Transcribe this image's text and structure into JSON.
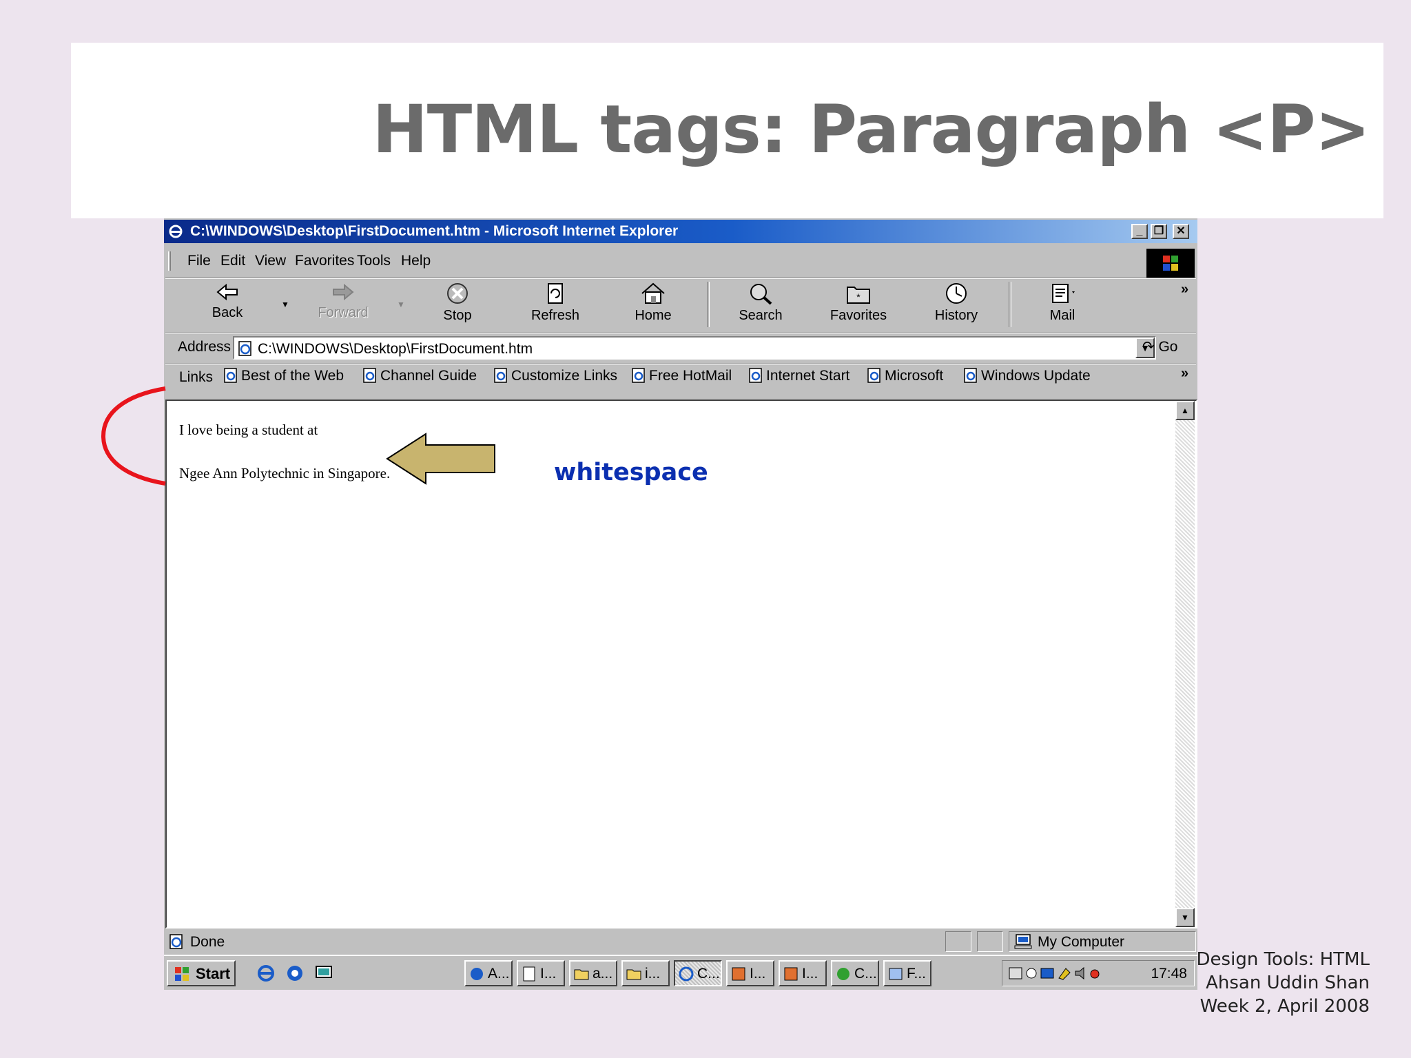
{
  "slide": {
    "title": "HTML tags: Paragraph <P>",
    "annotation": "whitespace",
    "footer": [
      "Design Tools: HTML",
      "Ahsan Uddin Shan",
      "Week 2, April 2008"
    ]
  },
  "window": {
    "title": "C:\\WINDOWS\\Desktop\\FirstDocument.htm - Microsoft Internet Explorer",
    "controls": [
      "minimize",
      "restore",
      "close"
    ]
  },
  "menu": [
    "File",
    "Edit",
    "View",
    "Favorites",
    "Tools",
    "Help"
  ],
  "toolbar": {
    "back": "Back",
    "forward": "Forward",
    "stop": "Stop",
    "refresh": "Refresh",
    "home": "Home",
    "search": "Search",
    "favorites": "Favorites",
    "history": "History",
    "mail": "Mail"
  },
  "address": {
    "label": "Address",
    "value": "C:\\WINDOWS\\Desktop\\FirstDocument.htm",
    "go": "Go"
  },
  "links": {
    "label": "Links",
    "items": [
      "Best of the Web",
      "Channel Guide",
      "Customize Links",
      "Free HotMail",
      "Internet Start",
      "Microsoft",
      "Windows Update"
    ]
  },
  "page": {
    "paragraph1": "I love being a student at",
    "paragraph2": "Ngee Ann Polytechnic in Singapore."
  },
  "status": {
    "text": "Done",
    "zone": "My Computer"
  },
  "taskbar": {
    "start": "Start",
    "tasks": [
      "A...",
      "I...",
      "a...",
      "i...",
      "C...",
      "I...",
      "I...",
      "C...",
      "F..."
    ],
    "clock": "17:48"
  },
  "colors": {
    "slide_background": "#ede4ee",
    "title_text": "#6b6b6b",
    "annotation_text": "#0b2fb0",
    "bracket": "#e8141c",
    "arrow_fill": "#c8b46e",
    "titlebar_start": "#0a2a8a",
    "titlebar_end": "#a6caf0"
  }
}
